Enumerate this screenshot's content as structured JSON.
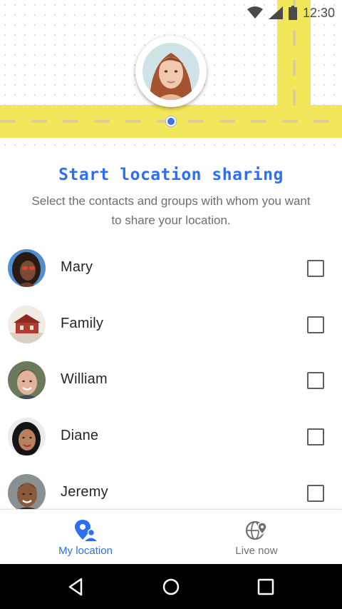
{
  "status_bar": {
    "time": "12:30"
  },
  "header": {
    "title": "Start location sharing",
    "subtitle": "Select the contacts and groups with whom you want to share your location."
  },
  "contacts": [
    {
      "name": "Mary",
      "checked": false
    },
    {
      "name": "Family",
      "checked": false
    },
    {
      "name": "William",
      "checked": false
    },
    {
      "name": "Diane",
      "checked": false
    },
    {
      "name": "Jeremy",
      "checked": false
    }
  ],
  "bottom_nav": {
    "tabs": [
      {
        "label": "My location",
        "icon": "person-pin-icon",
        "active": true
      },
      {
        "label": "Live now",
        "icon": "globe-pin-icon",
        "active": false
      }
    ]
  },
  "system_nav": {
    "buttons": [
      "back-icon",
      "home-icon",
      "recents-icon"
    ]
  },
  "colors": {
    "accent": "#2d6ff0",
    "road": "#f2e65a",
    "subtitle_text": "#6e6e6e",
    "system_bar": "#000000"
  }
}
